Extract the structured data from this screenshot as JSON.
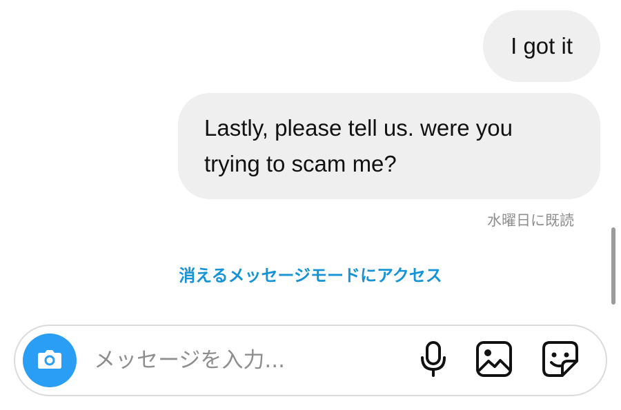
{
  "messages": [
    {
      "text": "I got it",
      "sender": "self"
    },
    {
      "text": "Lastly, please tell us. were you trying to scam me?",
      "sender": "self"
    }
  ],
  "read_receipt": "水曜日に既読",
  "vanish_mode_link": "消えるメッセージモードにアクセス",
  "composer": {
    "placeholder": "メッセージを入力...",
    "value": ""
  },
  "icons": {
    "camera": "camera-icon",
    "mic": "microphone-icon",
    "gallery": "image-icon",
    "sticker": "sticker-icon"
  },
  "colors": {
    "accent": "#2a9df4",
    "link": "#1493d6",
    "bubble": "#efefef",
    "muted_text": "#8e8e8e"
  }
}
